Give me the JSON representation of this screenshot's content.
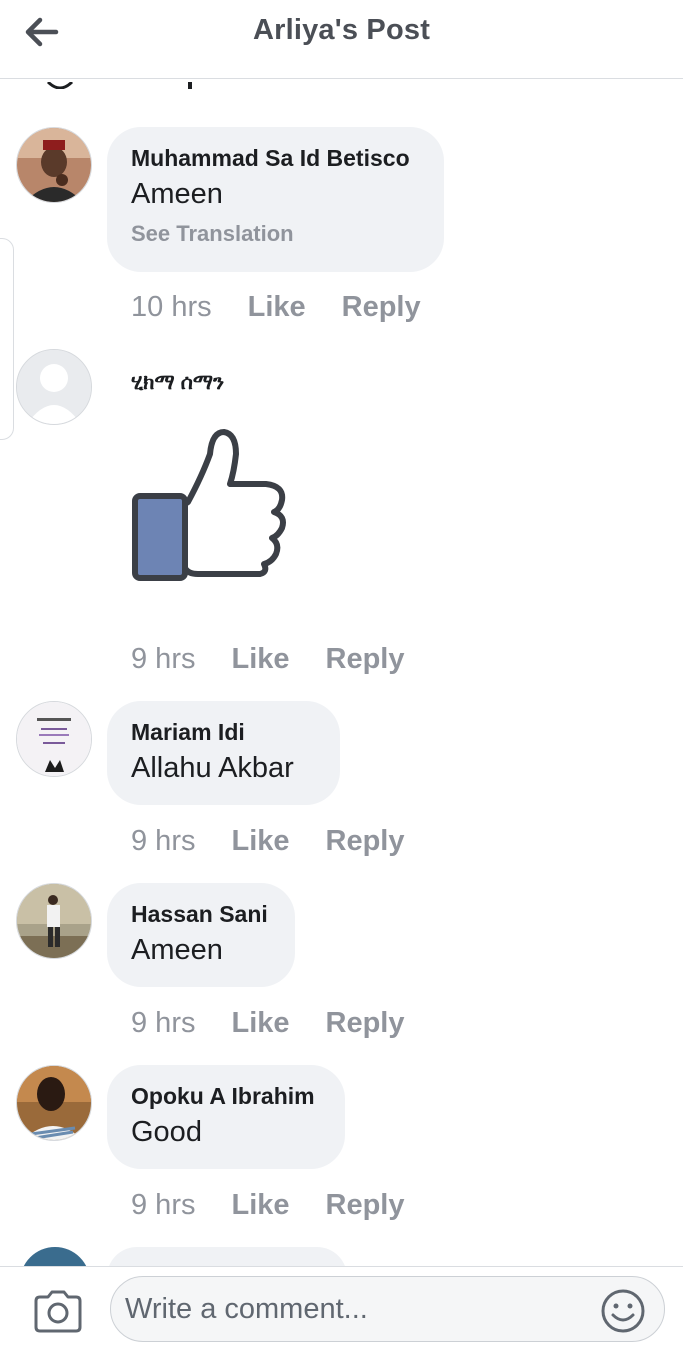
{
  "header": {
    "title": "Arliya's Post",
    "back_icon": "arrow-left-icon"
  },
  "comments": [
    {
      "author": "Muhammad Sa Id Betisco",
      "text": "Ameen",
      "translate": "See Translation",
      "time": "10 hrs",
      "like": "Like",
      "reply": "Reply"
    },
    {
      "author": "ሂክማ ሰማን",
      "sticker": "thumbs-up-icon",
      "time": "9 hrs",
      "like": "Like",
      "reply": "Reply"
    },
    {
      "author": "Mariam Idi",
      "text": "Allahu Akbar",
      "time": "9 hrs",
      "like": "Like",
      "reply": "Reply"
    },
    {
      "author": "Hassan Sani",
      "text": "Ameen",
      "time": "9 hrs",
      "like": "Like",
      "reply": "Reply"
    },
    {
      "author": "Opoku A Ibrahim",
      "text": "Good",
      "time": "9 hrs",
      "like": "Like",
      "reply": "Reply"
    }
  ],
  "composer": {
    "placeholder": "Write a comment...",
    "camera_icon": "camera-icon",
    "emoji_icon": "emoji-icon"
  },
  "colors": {
    "bubble": "#f0f2f5",
    "meta": "#90949c",
    "sticker_blue": "#6d84b4",
    "sticker_outline": "#3b3f46"
  }
}
